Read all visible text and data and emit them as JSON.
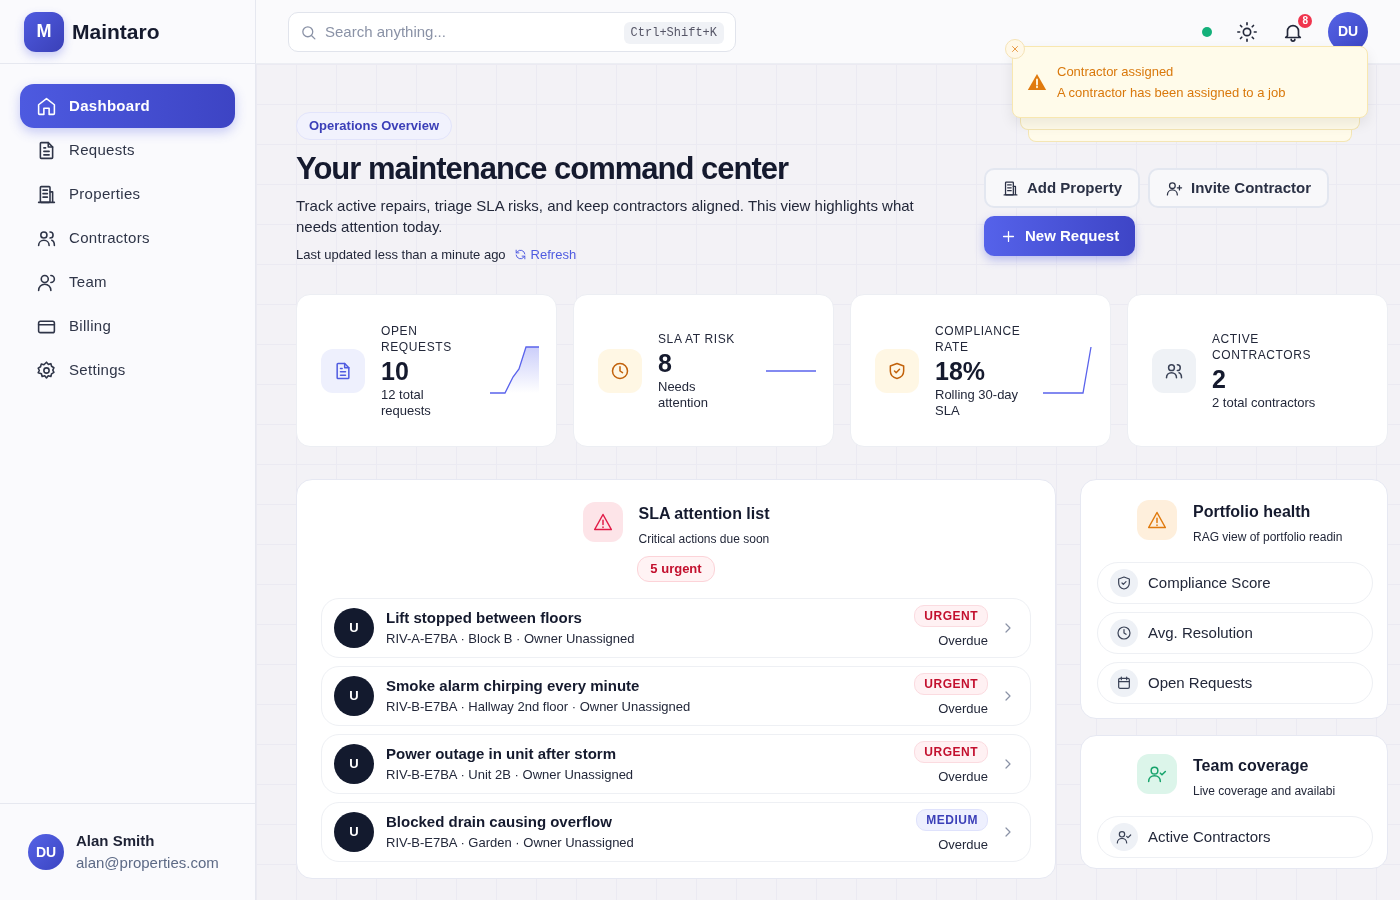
{
  "brand": {
    "logo_letter": "M",
    "name": "Maintaro"
  },
  "sidebar": {
    "items": [
      {
        "label": "Dashboard",
        "selected": true
      },
      {
        "label": "Requests",
        "selected": false
      },
      {
        "label": "Properties",
        "selected": false
      },
      {
        "label": "Contractors",
        "selected": false
      },
      {
        "label": "Team",
        "selected": false
      },
      {
        "label": "Billing",
        "selected": false
      },
      {
        "label": "Settings",
        "selected": false
      }
    ],
    "user": {
      "initials": "DU",
      "name": "Alan Smith",
      "email": "alan@properties.com"
    }
  },
  "topbar": {
    "search": {
      "placeholder": "Search anything...",
      "shortcut": "Ctrl+Shift+K"
    },
    "notifications_count": "8",
    "avatar_initials": "DU"
  },
  "toast": {
    "title": "Contractor assigned",
    "message": "A contractor has been assigned to a job"
  },
  "hero": {
    "eyebrow": "Operations Overview",
    "title": "Your maintenance command center",
    "description": "Track active repairs, triage SLA risks, and keep contractors aligned. This view highlights what needs attention today.",
    "updated": "Last updated less than a minute ago",
    "refresh": "Refresh",
    "actions": [
      {
        "label": "Add Property",
        "kind": "outline"
      },
      {
        "label": "Invite Contractor",
        "kind": "outline"
      },
      {
        "label": "New Request",
        "kind": "primary"
      }
    ]
  },
  "kpis": [
    {
      "label": "OPEN REQUESTS",
      "value": "10",
      "caption": "12 total requests",
      "kind": "ramp"
    },
    {
      "label": "SLA AT RISK",
      "value": "8",
      "caption": "Needs attention",
      "kind": "flat"
    },
    {
      "label": "COMPLIANCE RATE",
      "value": "18%",
      "caption": "Rolling 30-day SLA",
      "kind": "spike"
    },
    {
      "label": "ACTIVE CONTRACTORS",
      "value": "2",
      "caption": "2 total contractors",
      "kind": "none"
    }
  ],
  "sla": {
    "title": "SLA attention list",
    "subtitle": "Critical actions due soon",
    "badge": "5 urgent",
    "rows": [
      {
        "avatar": "U",
        "title": "Lift stopped between floors",
        "meta": "RIV-A-E7BA · Block B · Owner Unassigned",
        "priority": "URGENT",
        "kind": "urgent",
        "status": "Overdue"
      },
      {
        "avatar": "U",
        "title": "Smoke alarm chirping every minute",
        "meta": "RIV-B-E7BA · Hallway 2nd floor · Owner Unassigned",
        "priority": "URGENT",
        "kind": "urgent",
        "status": "Overdue"
      },
      {
        "avatar": "U",
        "title": "Power outage in unit after storm",
        "meta": "RIV-B-E7BA · Unit 2B · Owner Unassigned",
        "priority": "URGENT",
        "kind": "urgent",
        "status": "Overdue"
      },
      {
        "avatar": "U",
        "title": "Blocked drain causing overflow",
        "meta": "RIV-B-E7BA · Garden · Owner Unassigned",
        "priority": "MEDIUM",
        "kind": "medium",
        "status": "Overdue"
      }
    ]
  },
  "portfolio": {
    "title": "Portfolio health",
    "subtitle": "RAG view of portfolio readin",
    "rows": [
      {
        "label": "Compliance Score"
      },
      {
        "label": "Avg. Resolution"
      },
      {
        "label": "Open Requests"
      }
    ]
  },
  "team": {
    "title": "Team coverage",
    "subtitle": "Live coverage and availabi",
    "rows": [
      {
        "label": "Active Contractors"
      }
    ]
  }
}
